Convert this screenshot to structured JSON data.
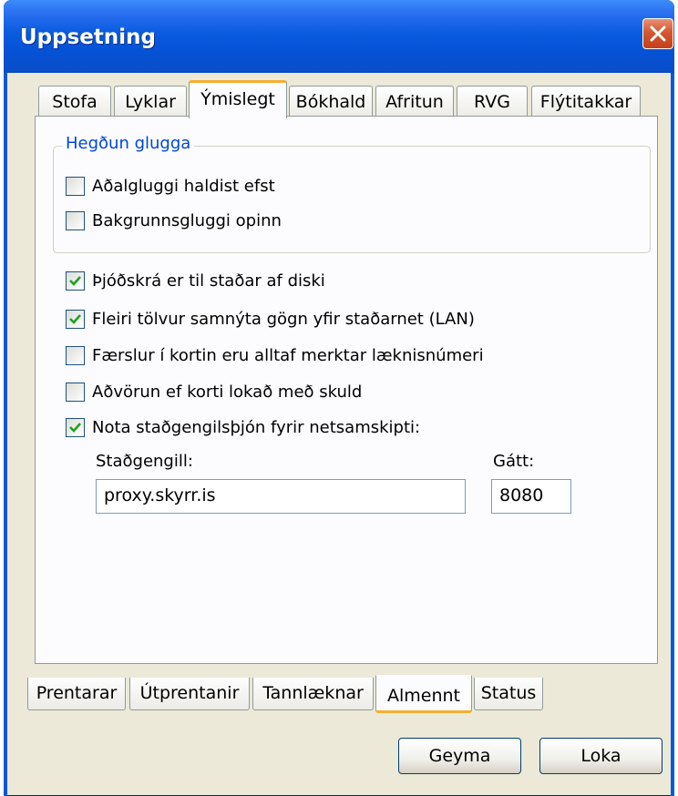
{
  "window": {
    "title": "Uppsetning"
  },
  "tabs_top": [
    "Stofa",
    "Lyklar",
    "Ýmislegt",
    "Bókhald",
    "Afritun",
    "RVG",
    "Flýtitakkar"
  ],
  "group": {
    "label": "Hegðun glugga",
    "items": [
      {
        "label": "Aðalgluggi haldist efst",
        "checked": false
      },
      {
        "label": "Bakgrunnsgluggi opinn",
        "checked": false
      }
    ]
  },
  "options": [
    {
      "label": "Þjóðskrá er til staðar af diski",
      "checked": true
    },
    {
      "label": "Fleiri tölvur samnýta gögn yfir staðarnet (LAN)",
      "checked": true
    },
    {
      "label": "Færslur í kortin eru alltaf merktar læknisnúmeri",
      "checked": false
    },
    {
      "label": "Aðvörun ef korti lokað með skuld",
      "checked": false
    },
    {
      "label": "Nota staðgengilsþjón fyrir netsamskipti:",
      "checked": true
    }
  ],
  "proxy": {
    "host_label": "Staðgengill:",
    "host_value": "proxy.skyrr.is",
    "port_label": "Gátt:",
    "port_value": "8080"
  },
  "tabs_bottom": [
    "Prentarar",
    "Útprentanir",
    "Tannlæknar",
    "Almennt",
    "Status"
  ],
  "buttons": {
    "save": "Geyma",
    "close": "Loka"
  }
}
